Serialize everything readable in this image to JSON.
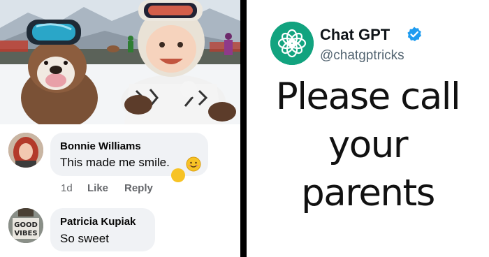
{
  "photo": {
    "description_icons": [
      "bulldog-image",
      "baby-image"
    ]
  },
  "comments": [
    {
      "author": "Bonnie Williams",
      "text": "This made me smile.",
      "emoji": "😊",
      "time": "1d",
      "like_label": "Like",
      "reply_label": "Reply"
    },
    {
      "author": "Patricia Kupiak",
      "text": "So sweet",
      "avatar_sign": "GOOD VIBES"
    }
  ],
  "tweet": {
    "name": "Chat GPT",
    "handle": "@chatgptricks",
    "lines": [
      "Please call",
      "your",
      "parents"
    ],
    "brand_color": "#12a37f",
    "verified_color": "#1d9bf0"
  }
}
